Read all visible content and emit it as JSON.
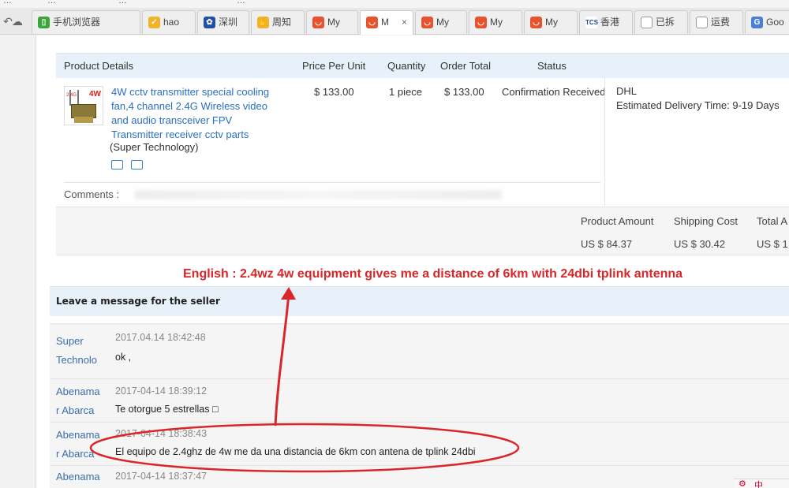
{
  "top_strip": [
    "…",
    "手机浏览器",
    "…",
    "…",
    "…"
  ],
  "tabs": [
    {
      "label": "手机浏览器",
      "icon": "phone-browser-icon",
      "active": false
    },
    {
      "label": "hao",
      "icon": "hao123-icon",
      "active": false
    },
    {
      "label": "深圳",
      "icon": "paw-icon",
      "active": false
    },
    {
      "label": "周知",
      "icon": "hand-icon",
      "active": false
    },
    {
      "label": "My",
      "icon": "aliexpress-icon",
      "active": false
    },
    {
      "label": "M",
      "icon": "aliexpress-icon",
      "active": true
    },
    {
      "label": "My",
      "icon": "aliexpress-icon",
      "active": false
    },
    {
      "label": "My",
      "icon": "aliexpress-icon",
      "active": false
    },
    {
      "label": "My",
      "icon": "aliexpress-icon",
      "active": false
    },
    {
      "label": "香港",
      "icon": "tcs-icon",
      "active": false
    },
    {
      "label": "已拆",
      "icon": "document-icon",
      "active": false
    },
    {
      "label": "运费",
      "icon": "document-icon",
      "active": false
    },
    {
      "label": "Goo",
      "icon": "google-translate-icon",
      "active": false
    }
  ],
  "order_table": {
    "headers": {
      "product": "Product Details",
      "price": "Price Per Unit",
      "quantity": "Quantity",
      "total": "Order Total",
      "status": "Status"
    },
    "item": {
      "thumb_badge": "4W",
      "thumb_small": "2.4G",
      "title": "4W cctv transmitter special cooling fan,4 channel 2.4G Wireless video and audio transceiver FPV Transmitter receiver cctv parts",
      "store": "(Super Technology)",
      "price": "$ 133.00",
      "quantity": "1 piece",
      "total": "$ 133.00",
      "status": "Confirmation Received",
      "carrier": "DHL",
      "delivery": "Estimated Delivery Time:  9-19 Days"
    },
    "comments_label": "Comments :"
  },
  "summary": {
    "product_amount_label": "Product Amount",
    "product_amount": "US $ 84.37",
    "shipping_cost_label": "Shipping Cost",
    "shipping_cost": "US $ 30.42",
    "total_label": "Total A",
    "total": "US $ 1"
  },
  "annotation": "English : 2.4wz 4w equipment gives me a distance of 6km with 24dbi tplink antenna",
  "messages_header": "Leave a message for the seller",
  "messages": [
    {
      "author": "Super Technolo",
      "author_l1": "Super",
      "author_l2": "Technolo",
      "time": "2017.04.14 18:42:48",
      "body": "ok ,"
    },
    {
      "author": "Abenamar Abarca",
      "author_l1": "Abenama",
      "author_l2": "r Abarca",
      "time": "2017-04-14 18:39:12",
      "body": "Te otorgue 5 estrellas □"
    },
    {
      "author": "Abenamar Abarca",
      "author_l1": "Abenama",
      "author_l2": "r Abarca",
      "time": "2017-04-14 18:38:43",
      "body": "El equipo de 2.4ghz de 4w me da una distancia de 6km con antena de tplink 24dbi"
    },
    {
      "author": "Abenamar",
      "author_l1": "Abenama",
      "author_l2": "",
      "time": "2017-04-14 18:37:47",
      "body": ""
    }
  ],
  "corner_tool": "中",
  "colors": {
    "link": "#2a6fbf",
    "annotation_red": "#d8262a",
    "header_blue": "#e8f0fa",
    "author_blue": "#3a6fa8"
  }
}
